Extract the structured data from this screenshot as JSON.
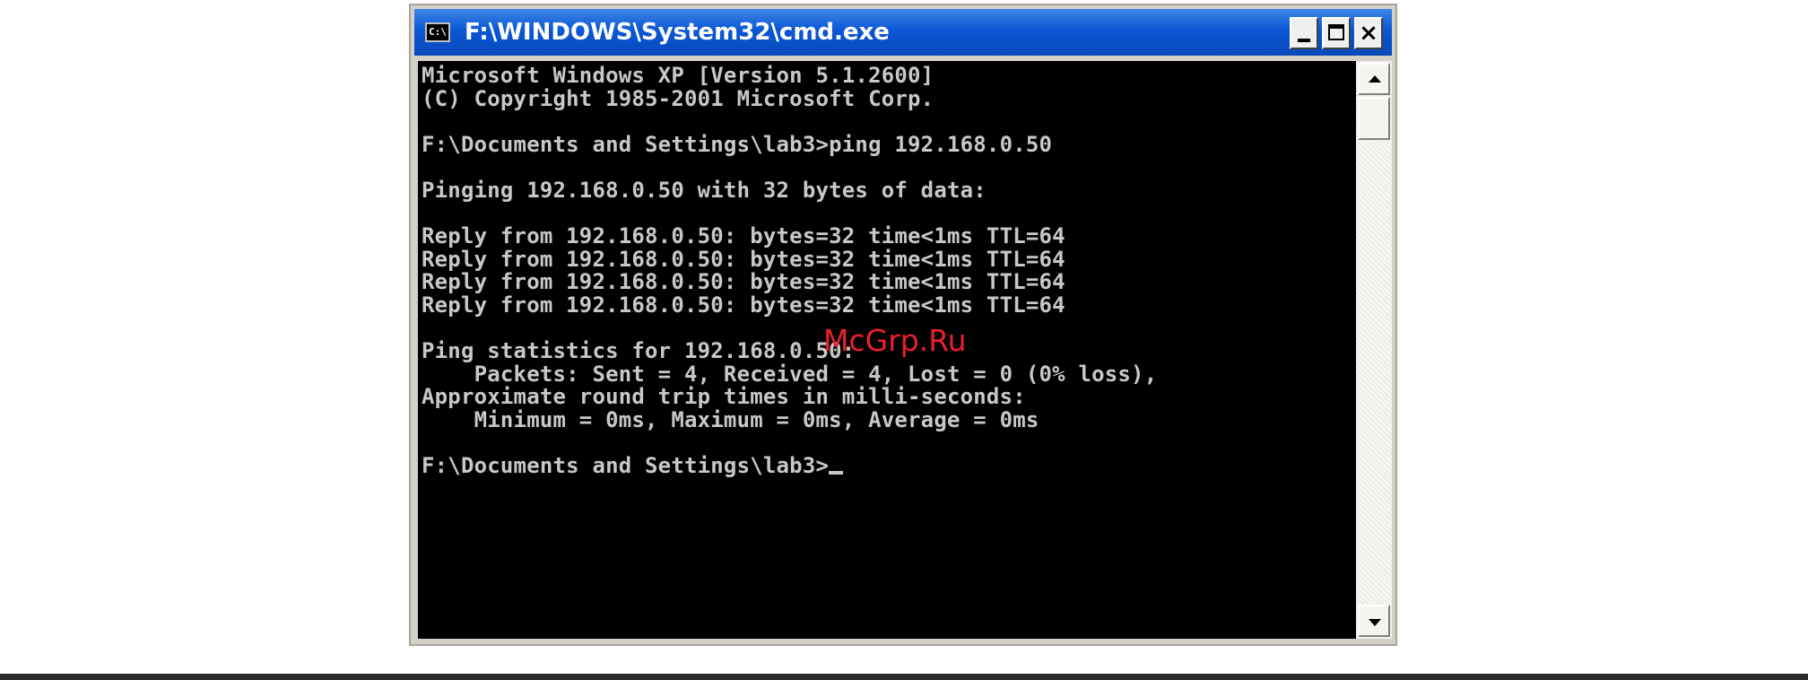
{
  "window": {
    "title": "F:\\WINDOWS\\System32\\cmd.exe",
    "icon_label": "C:\\",
    "controls": {
      "minimize": "minimize-icon",
      "maximize": "maximize-icon",
      "close": "×"
    }
  },
  "console": {
    "lines": [
      "Microsoft Windows XP [Version 5.1.2600]",
      "(C) Copyright 1985-2001 Microsoft Corp.",
      "",
      "F:\\Documents and Settings\\lab3>ping 192.168.0.50",
      "",
      "Pinging 192.168.0.50 with 32 bytes of data:",
      "",
      "Reply from 192.168.0.50: bytes=32 time<1ms TTL=64",
      "Reply from 192.168.0.50: bytes=32 time<1ms TTL=64",
      "Reply from 192.168.0.50: bytes=32 time<1ms TTL=64",
      "Reply from 192.168.0.50: bytes=32 time<1ms TTL=64",
      "",
      "Ping statistics for 192.168.0.50:",
      "    Packets: Sent = 4, Received = 4, Lost = 0 (0% loss),",
      "Approximate round trip times in milli-seconds:",
      "    Minimum = 0ms, Maximum = 0ms, Average = 0ms",
      "",
      "F:\\Documents and Settings\\lab3>"
    ],
    "text_color": "#c8c8c8",
    "background": "#000000"
  },
  "watermark": "McGrp.Ru",
  "colors": {
    "titlebar": "#0a57d6",
    "watermark": "#e8202a"
  }
}
